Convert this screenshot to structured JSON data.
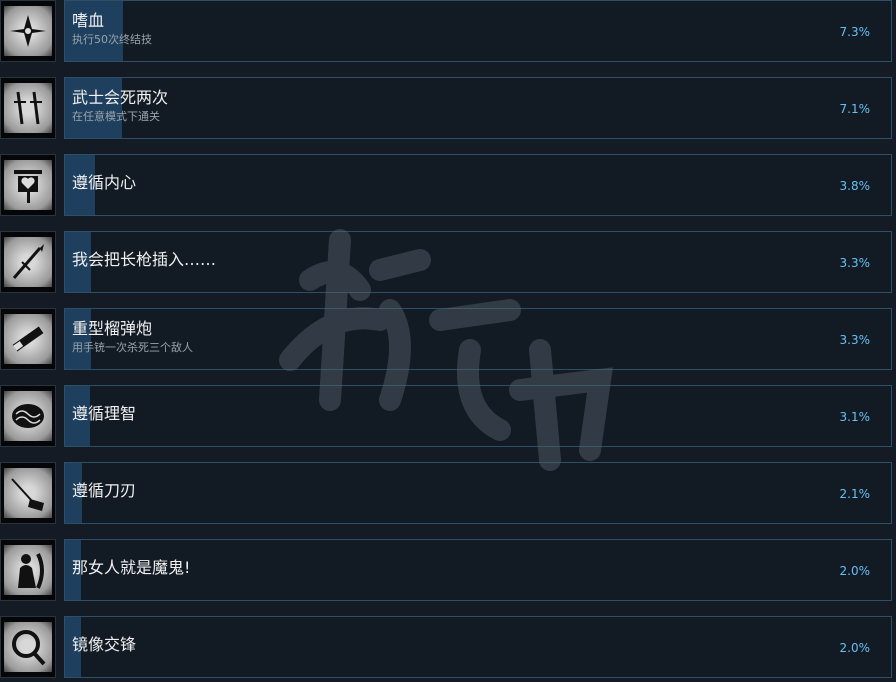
{
  "achievements": [
    {
      "title": "嗜血",
      "desc": "执行50次终结技",
      "percent": "7.3%",
      "progress": 0.073,
      "icon": "shuriken-icon"
    },
    {
      "title": "武士会死两次",
      "desc": "在任意模式下通关",
      "percent": "7.1%",
      "progress": 0.071,
      "icon": "crossed-swords-icon"
    },
    {
      "title": "遵循内心",
      "desc": "",
      "percent": "3.8%",
      "progress": 0.038,
      "icon": "shrine-heart-icon"
    },
    {
      "title": "我会把长枪插入……",
      "desc": "",
      "percent": "3.3%",
      "progress": 0.033,
      "icon": "spear-icon"
    },
    {
      "title": "重型榴弹炮",
      "desc": "用手铳一次杀死三个敌人",
      "percent": "3.3%",
      "progress": 0.033,
      "icon": "cannon-icon"
    },
    {
      "title": "遵循理智",
      "desc": "",
      "percent": "3.1%",
      "progress": 0.031,
      "icon": "brain-icon"
    },
    {
      "title": "遵循刀刃",
      "desc": "",
      "percent": "2.1%",
      "progress": 0.021,
      "icon": "katana-hand-icon"
    },
    {
      "title": "那女人就是魔鬼!",
      "desc": "",
      "percent": "2.0%",
      "progress": 0.02,
      "icon": "silhouette-icon"
    },
    {
      "title": "镜像交锋",
      "desc": "",
      "percent": "2.0%",
      "progress": 0.02,
      "icon": "mirror-icon"
    }
  ],
  "colors": {
    "bar": "#1e3f5d",
    "percent": "#66c0f4",
    "border": "#2d4f67"
  }
}
